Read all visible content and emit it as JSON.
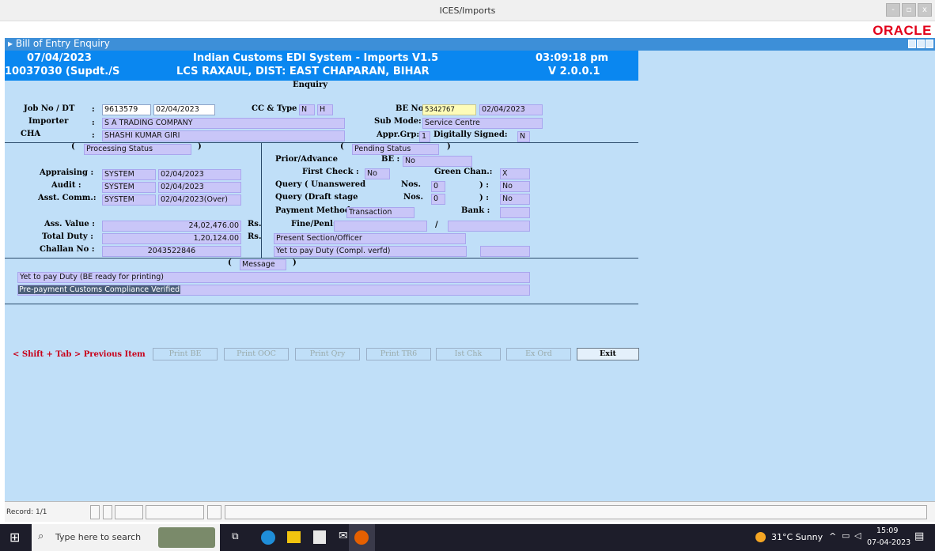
{
  "window": {
    "title": "ICES/Imports",
    "controls": [
      "-",
      "▫",
      "x"
    ]
  },
  "brand": {
    "logo": "ORACLE"
  },
  "frame": {
    "title": "Bill of Entry Enquiry"
  },
  "header": {
    "date": "07/04/2023",
    "user": "10037030 (Supdt./S",
    "system": "Indian Customs EDI System - Imports V1.5",
    "location": "LCS RAXAUL, DIST: EAST CHAPARAN, BIHAR",
    "time": "03:09:18 pm",
    "version": "V 2.0.0.1"
  },
  "form": {
    "section_title": "Enquiry",
    "job_label": "Job No / DT",
    "colon": ":",
    "job_no": "9613579",
    "job_date": "02/04/2023",
    "cc_type_label": "CC & Type :",
    "cc": "N",
    "type": "H",
    "be_no_label": "BE No:",
    "be_no": "5342767",
    "be_date": "02/04/2023",
    "importer_label": "Importer",
    "importer": "S A TRADING COMPANY",
    "sub_mode_label": "Sub Mode:",
    "sub_mode": "Service Centre",
    "cha_label": "CHA",
    "cha": "SHASHI KUMAR GIRI",
    "appr_grp_label": "Appr.Grp:",
    "appr_grp": "1",
    "dig_signed_label": "Digitally Signed:",
    "dig_signed": "N",
    "open_paren": "(",
    "close_paren": ")",
    "processing_status": "Processing Status",
    "pending_status": "Pending Status",
    "appraising_label": "Appraising :",
    "appraising_by": "SYSTEM",
    "appraising_date": "02/04/2023",
    "audit_label": "Audit :",
    "audit_by": "SYSTEM",
    "audit_date": "02/04/2023",
    "asst_comm_label": "Asst. Comm.:",
    "asst_comm_by": "SYSTEM",
    "asst_comm_date": "02/04/2023(Over)",
    "prior_advance_label": "Prior/Advance",
    "be_label": "BE :",
    "prior_be": "No",
    "first_check_label": "First Check :",
    "first_check": "No",
    "green_chan_label": "Green Chan.:",
    "green_chan": "X",
    "query_unans_label": "Query ( Unanswered",
    "query_draft_label": "Query (Draft stage",
    "nos_label": "Nos.",
    "close_colon": ") :",
    "query_unans_nos": "0",
    "query_unans_flag": "No",
    "query_draft_nos": "0",
    "query_draft_flag": "No",
    "payment_method_label": "Payment Method",
    "payment_method": "Transaction",
    "bank_label": "Bank :",
    "bank": "",
    "ass_value_label": "Ass. Value :",
    "ass_value": "24,02,476.00",
    "rs": "Rs.",
    "total_duty_label": "Total Duty :",
    "total_duty": "1,20,124.00",
    "challan_label": "Challan No :",
    "challan_no": "2043522846",
    "fine_penl_label": "Fine/Penl:",
    "fine_penl": "",
    "slash": "/",
    "fine_penl2": "",
    "present_section": "Present Section/Officer",
    "yet_to_pay": "Yet to pay Duty (Compl. verfd)",
    "officer": "",
    "message_label": "Message",
    "messages": [
      "Yet to pay Duty  (BE ready for printing)",
      "Pre-payment Customs Compliance Verified"
    ]
  },
  "buttons": {
    "prev_hint": "< Shift + Tab > Previous Item",
    "print_be": "Print BE",
    "print_ooc": "Print OOC",
    "print_qry": "Print Qry",
    "print_tr6": "Print TR6",
    "ist_chk": "Ist Chk",
    "ex_ord": "Ex Ord",
    "exit": "Exit"
  },
  "status": {
    "record": "Record: 1/1"
  },
  "taskbar": {
    "search_placeholder": "Type here to search",
    "weather": "31°C  Sunny",
    "time": "15:09",
    "date": "07-04-2023"
  },
  "colors": {
    "header_blue": "#0a87f0",
    "form_bg": "#c0dff8",
    "field_purple": "#c9c6f8",
    "alert_red": "#c8001a"
  }
}
